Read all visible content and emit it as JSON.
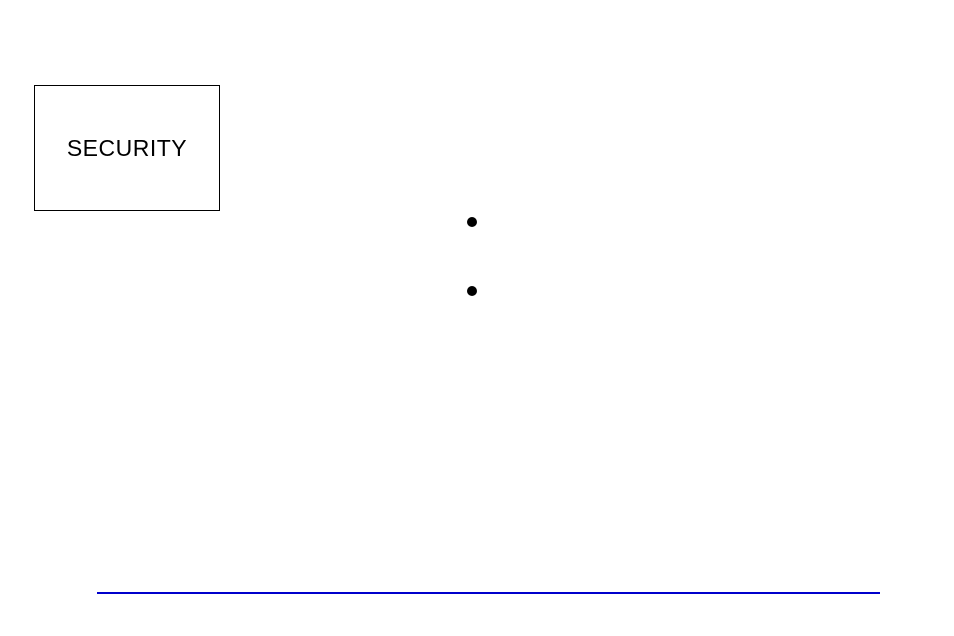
{
  "box": {
    "label": "SECURITY"
  }
}
